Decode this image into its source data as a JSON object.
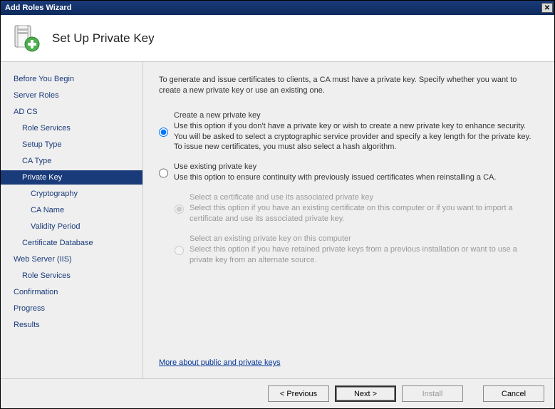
{
  "window": {
    "title": "Add Roles Wizard"
  },
  "header": {
    "title": "Set Up Private Key"
  },
  "sidebar": {
    "items": [
      {
        "label": "Before You Begin",
        "indent": 0
      },
      {
        "label": "Server Roles",
        "indent": 0
      },
      {
        "label": "AD CS",
        "indent": 0
      },
      {
        "label": "Role Services",
        "indent": 1
      },
      {
        "label": "Setup Type",
        "indent": 1
      },
      {
        "label": "CA Type",
        "indent": 1
      },
      {
        "label": "Private Key",
        "indent": 1,
        "selected": true
      },
      {
        "label": "Cryptography",
        "indent": 2
      },
      {
        "label": "CA Name",
        "indent": 2
      },
      {
        "label": "Validity Period",
        "indent": 2
      },
      {
        "label": "Certificate Database",
        "indent": 1
      },
      {
        "label": "Web Server (IIS)",
        "indent": 0
      },
      {
        "label": "Role Services",
        "indent": 1
      },
      {
        "label": "Confirmation",
        "indent": 0
      },
      {
        "label": "Progress",
        "indent": 0
      },
      {
        "label": "Results",
        "indent": 0
      }
    ]
  },
  "content": {
    "intro": "To generate and issue certificates to clients, a CA must have a private key. Specify whether you want to create a new private key or use an existing one.",
    "options": [
      {
        "label": "Create a new private key",
        "desc": "Use this option if you don't have a private key or wish to create a new private key to enhance security. You will be asked to select a cryptographic service provider and specify a key length for the private key. To issue new certificates, you must also select a hash algorithm.",
        "checked": true
      },
      {
        "label": "Use existing private key",
        "desc": "Use this option to ensure continuity with previously issued certificates when reinstalling a CA.",
        "checked": false,
        "suboptions": [
          {
            "label": "Select a certificate and use its associated private key",
            "desc": "Select this option if you have an existing certificate on this computer or if you want to import a certificate and use its associated private key.",
            "checked": true,
            "disabled": true
          },
          {
            "label": "Select an existing private key on this computer",
            "desc": "Select this option if you have retained private keys from a previous installation or want to use a private key from an alternate source.",
            "checked": false,
            "disabled": true
          }
        ]
      }
    ],
    "link": "More about public and private keys"
  },
  "footer": {
    "previous": "< Previous",
    "next": "Next >",
    "install": "Install",
    "cancel": "Cancel"
  }
}
